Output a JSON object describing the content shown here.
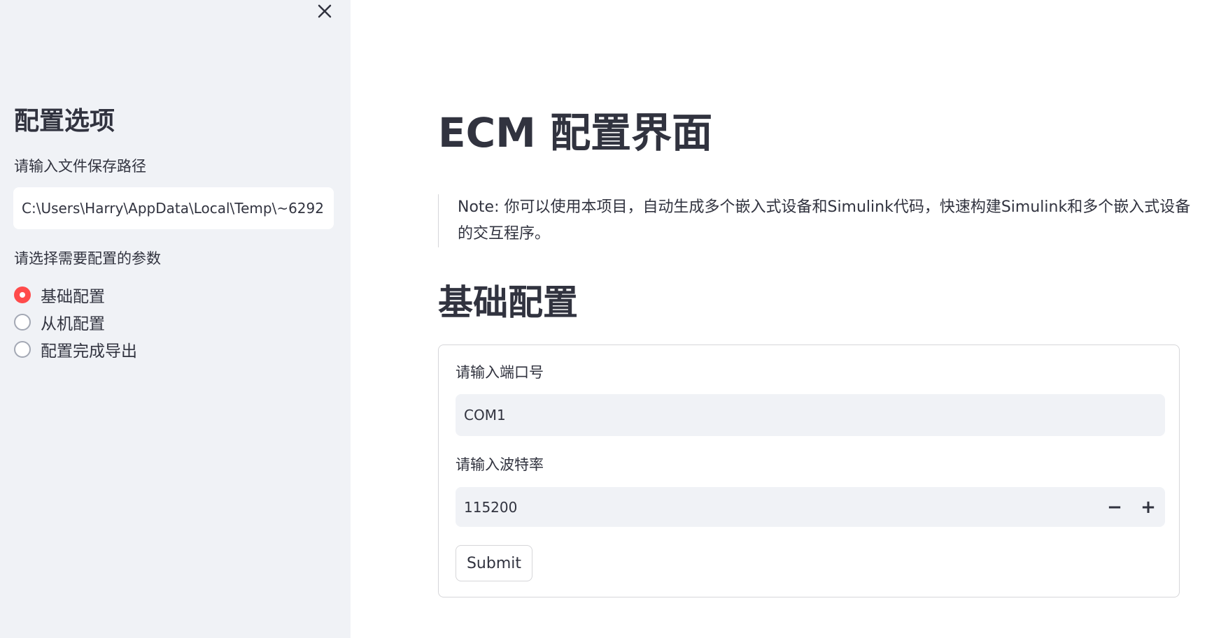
{
  "sidebar": {
    "close_icon": "close-icon",
    "title": "配置选项",
    "path_label": "请输入文件保存路径",
    "path_value": "C:\\Users\\Harry\\AppData\\Local\\Temp\\~6292",
    "param_label": "请选择需要配置的参数",
    "options": [
      {
        "label": "基础配置",
        "checked": true
      },
      {
        "label": "从机配置",
        "checked": false
      },
      {
        "label": "配置完成导出",
        "checked": false
      }
    ],
    "accent_color": "#ff4b4b"
  },
  "main": {
    "title": "ECM 配置界面",
    "note": "Note: 你可以使用本项目，自动生成多个嵌入式设备和Simulink代码，快速构建Simulink和多个嵌入式设备的交互程序。",
    "section_title": "基础配置",
    "form": {
      "port_label": "请输入端口号",
      "port_value": "COM1",
      "baud_label": "请输入波特率",
      "baud_value": "115200",
      "decrement_label": "−",
      "increment_label": "+",
      "submit_label": "Submit"
    }
  }
}
